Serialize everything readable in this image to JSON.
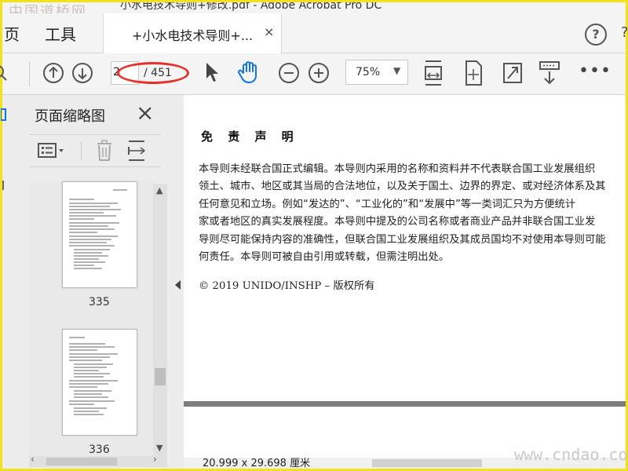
{
  "window": {
    "title": "小水电技术导则+修改.pdf - Adobe Acrobat Pro DC"
  },
  "watermarks": {
    "top": "中国道桥网",
    "bottom": "www.cndao.com"
  },
  "menubar": {
    "home": "页",
    "tools": "工具"
  },
  "tab": {
    "label": "+小水电技术导则+...",
    "close": "×"
  },
  "help": {
    "label": "?"
  },
  "edge_glyph": "?",
  "toolbar": {
    "current_page": "2",
    "total_pages": "/ 451",
    "zoom": "75%",
    "more": "•••"
  },
  "thumbnails": {
    "title": "页面缩略图",
    "close": "×",
    "pages": [
      {
        "number": "335"
      },
      {
        "number": "336"
      }
    ]
  },
  "document": {
    "heading": "免 责 声 明",
    "lines": [
      "本导则未经联合国正式编辑。本导则内采用的名称和资料并不代表联合国工业发展组织",
      "领土、城市、地区或其当局的合法地位，以及关于国土、边界的界定、或对经济体系及其",
      "任何意见和立场。例如“发达的”、“工业化的”和“发展中”等一类词汇只为方便统计",
      "家或者地区的真实发展程度。本导则中提及的公司名称或者商业产品并非联合国工业发",
      "导则尽可能保持内容的准确性，但联合国工业发展组织及其成员国均不对使用本导则可能",
      "何责任。本导则可被自由引用或转载，但需注明出处。"
    ],
    "copyright": "© 2019 UNIDO/INSHP –  版权所有"
  },
  "status": {
    "page_size": "20.999 x 29.698 厘米"
  },
  "colors": {
    "frame": "#f2e21a",
    "annotation_ellipse": "#e8302a",
    "hand_tool": "#1473e6"
  }
}
